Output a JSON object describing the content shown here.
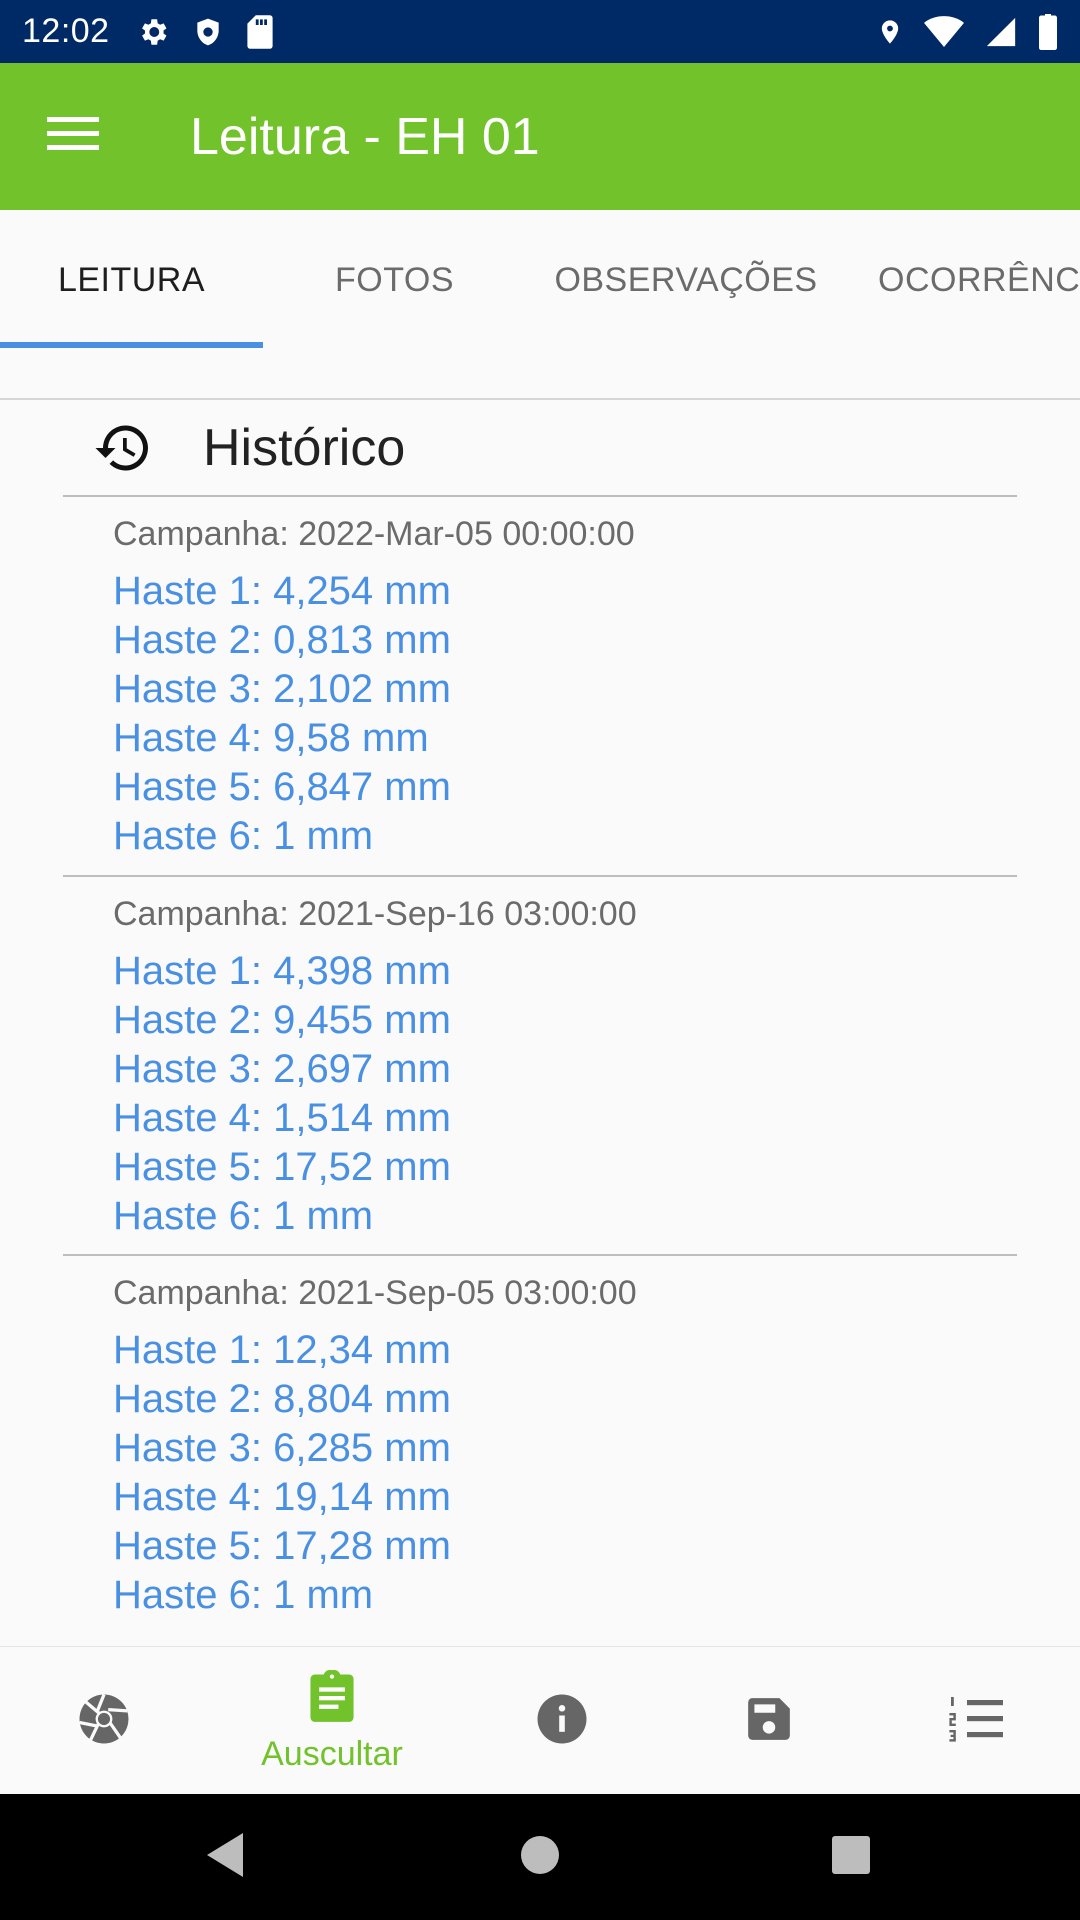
{
  "status_bar": {
    "time": "12:02",
    "left_icons": [
      "settings-icon",
      "shield-icon",
      "sd-card-icon"
    ],
    "right_icons": [
      "location-icon",
      "wifi-icon",
      "signal-icon",
      "battery-icon"
    ]
  },
  "app_bar": {
    "title": "Leitura - EH 01",
    "menu_icon": "hamburger-menu-icon",
    "background": "#72c22b"
  },
  "tabs": [
    {
      "label": "LEITURA",
      "active": true
    },
    {
      "label": "FOTOS",
      "active": false
    },
    {
      "label": "OBSERVAÇÕES",
      "active": false
    },
    {
      "label": "OCORRÊNCI",
      "active": false
    }
  ],
  "history": {
    "title": "Histórico",
    "icon": "history-icon",
    "campaigns": [
      {
        "label": "Campanha: 2022-Mar-05 00:00:00",
        "hastes": [
          "Haste 1: 4,254 mm",
          "Haste 2: 0,813 mm",
          "Haste 3: 2,102 mm",
          "Haste 4: 9,58 mm",
          "Haste 5: 6,847 mm",
          "Haste 6: 1 mm"
        ]
      },
      {
        "label": "Campanha: 2021-Sep-16 03:00:00",
        "hastes": [
          "Haste 1: 4,398 mm",
          "Haste 2: 9,455 mm",
          "Haste 3: 2,697 mm",
          "Haste 4: 1,514 mm",
          "Haste 5: 17,52 mm",
          "Haste 6: 1 mm"
        ]
      },
      {
        "label": "Campanha: 2021-Sep-05 03:00:00",
        "hastes": [
          "Haste 1: 12,34 mm",
          "Haste 2: 8,804 mm",
          "Haste 3: 6,285 mm",
          "Haste 4: 19,14 mm",
          "Haste 5: 17,28 mm",
          "Haste 6: 1 mm"
        ]
      }
    ]
  },
  "bottom_nav": {
    "items": [
      {
        "icon": "camera-shutter-icon",
        "label": ""
      },
      {
        "icon": "clipboard-icon",
        "label": "Auscultar",
        "active": true
      },
      {
        "icon": "info-icon",
        "label": ""
      },
      {
        "icon": "save-icon",
        "label": ""
      },
      {
        "icon": "numbered-list-icon",
        "label": ""
      }
    ],
    "active_color": "#72c22b"
  },
  "system_nav": {
    "buttons": [
      "back-icon",
      "home-icon",
      "recents-icon"
    ]
  },
  "colors": {
    "status_bar": "#002a66",
    "accent_blue": "#4a90e2"
  }
}
